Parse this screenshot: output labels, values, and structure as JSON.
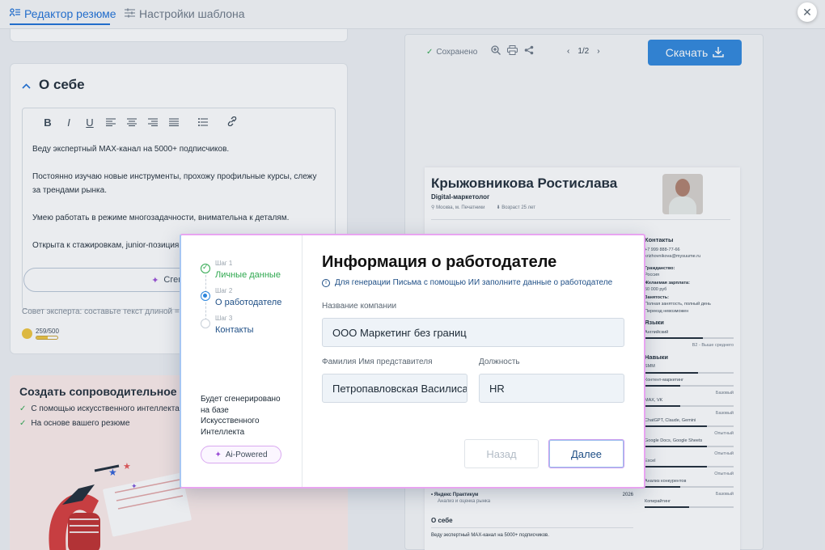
{
  "tabs": [
    {
      "label": "Редактор резюме",
      "active": true
    },
    {
      "label": "Настройки шаблона",
      "active": false
    }
  ],
  "about": {
    "title": "О себе",
    "toolbar": [
      "B",
      "I",
      "U"
    ],
    "paragraphs": [
      "Веду экспертный MAX-канал на 5000+ подписчиков.",
      "Постоянно изучаю новые инструменты, прохожу профильные курсы, слежу за трендами рынка.",
      "Умею работать в режиме многозадачности, внимательна к деталям.",
      "Открыта к стажировкам, junior-позиция"
    ],
    "generate_label": "Сгенерир",
    "expert_tip": "Совет эксперта: составьте текст длиной = интересно",
    "counter": "259/500",
    "counter_fill": 0.52
  },
  "cover": {
    "title": "Создать сопроводительное",
    "items": [
      "С помощью искусственного интеллекта",
      "На основе вашего резюме"
    ]
  },
  "preview": {
    "saved": "Сохранено",
    "page": "1/2",
    "download": "Скачать"
  },
  "resume": {
    "name": "Крыжовникова Ростислава",
    "role": "Digital-маркетолог",
    "location": "Москва, м. Печатники",
    "age": "Возраст 25 лет",
    "contacts_title": "Контакты",
    "phone": "+7 999 888-77-66",
    "email": "krizhovnikova@mysuume.ru",
    "citizenship_title": "Гражданство:",
    "citizenship": "Россия",
    "salary_title": "Желаемая зарплата:",
    "salary": "50 000 руб",
    "employment_title": "Занятость:",
    "employment": "Полная занятость, полный день",
    "relocation": "Переезд невозможен",
    "languages_title": "Языки",
    "language": "Английский",
    "language_level": "B2 - Выше среднего",
    "language_fill": 0.65,
    "skills_title": "Навыки",
    "skills": [
      {
        "name": "SMM",
        "level": "",
        "fill": 0.6
      },
      {
        "name": "Контент-маркетинг",
        "level": "Базовый",
        "fill": 0.4
      },
      {
        "name": "MAX, VK",
        "level": "Базовый",
        "fill": 0.4
      },
      {
        "name": "ChatGPT, Claude, Gemini",
        "level": "Опытный",
        "fill": 0.7
      },
      {
        "name": "Google Docs, Google Sheets",
        "level": "Опытный",
        "fill": 0.7
      },
      {
        "name": "Excel",
        "level": "Опытный",
        "fill": 0.7
      },
      {
        "name": "Анализ конкурентов",
        "level": "Базовый",
        "fill": 0.4
      },
      {
        "name": "Копирайтинг",
        "level": "",
        "fill": 0.5
      }
    ],
    "edu_school": "Яндекс Практикум",
    "edu_year": "2026",
    "edu_course": "Анализ и оценка рынка",
    "about_title": "О себе",
    "about_text": "Веду экспертный MAX-канал на 5000+ подписчиков."
  },
  "modal": {
    "title": "Информация о работодателе",
    "subtitle": "Для генерации Письма с помощью ИИ заполните данные о работодателе",
    "steps": [
      {
        "small": "Шаг 1",
        "label": "Личные данные",
        "state": "done"
      },
      {
        "small": "Шаг 2",
        "label": "О работодателе",
        "state": "current"
      },
      {
        "small": "Шаг 3",
        "label": "Контакты",
        "state": "pending"
      }
    ],
    "ai_note": "Будет сгенерировано на базе Искусственного Интеллекта",
    "ai_badge": "Ai-Powered",
    "company_label": "Название компании",
    "company_value": "ООО Маркетинг без границ",
    "rep_label": "Фамилия Имя представителя",
    "rep_value": "Петропавловская Василиса",
    "position_label": "Должность",
    "position_value": "HR",
    "back_label": "Назад",
    "next_label": "Далее"
  }
}
